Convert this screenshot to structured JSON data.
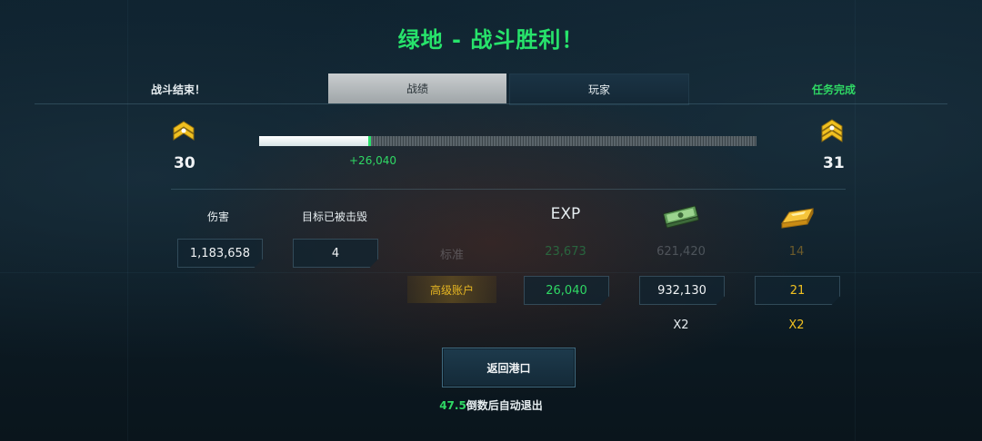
{
  "title": "绿地 - 战斗胜利！",
  "header": {
    "battle_end": "战斗结束！",
    "mission_complete": "任务完成",
    "tabs": [
      {
        "label": "战绩",
        "active": true
      },
      {
        "label": "玩家",
        "active": false
      }
    ]
  },
  "rank": {
    "current_level": "30",
    "next_level": "31",
    "progress_fraction": 0.22,
    "exp_gain": "+26,040"
  },
  "stats": {
    "damage_label": "伤害",
    "damage_value": "1,183,658",
    "kills_label": "目标已被击毁",
    "kills_value": "4"
  },
  "rewards": {
    "exp_header": "EXP",
    "cash_icon": "cash-stack-icon",
    "gold_icon": "gold-bar-icon",
    "standard": {
      "label": "标准",
      "exp": "23,673",
      "cash": "621,420",
      "gold": "14"
    },
    "premium": {
      "label": "高级账户",
      "exp": "26,040",
      "cash": "932,130",
      "gold": "21"
    },
    "multipliers": {
      "cash": "X2",
      "gold": "X2"
    }
  },
  "actions": {
    "return_label": "返回港口",
    "countdown_value": "47.5",
    "countdown_suffix": "倒数后自动退出"
  },
  "colors": {
    "accent_green": "#2fd864",
    "accent_gold": "#f0c020",
    "background": "#0d1d27"
  }
}
